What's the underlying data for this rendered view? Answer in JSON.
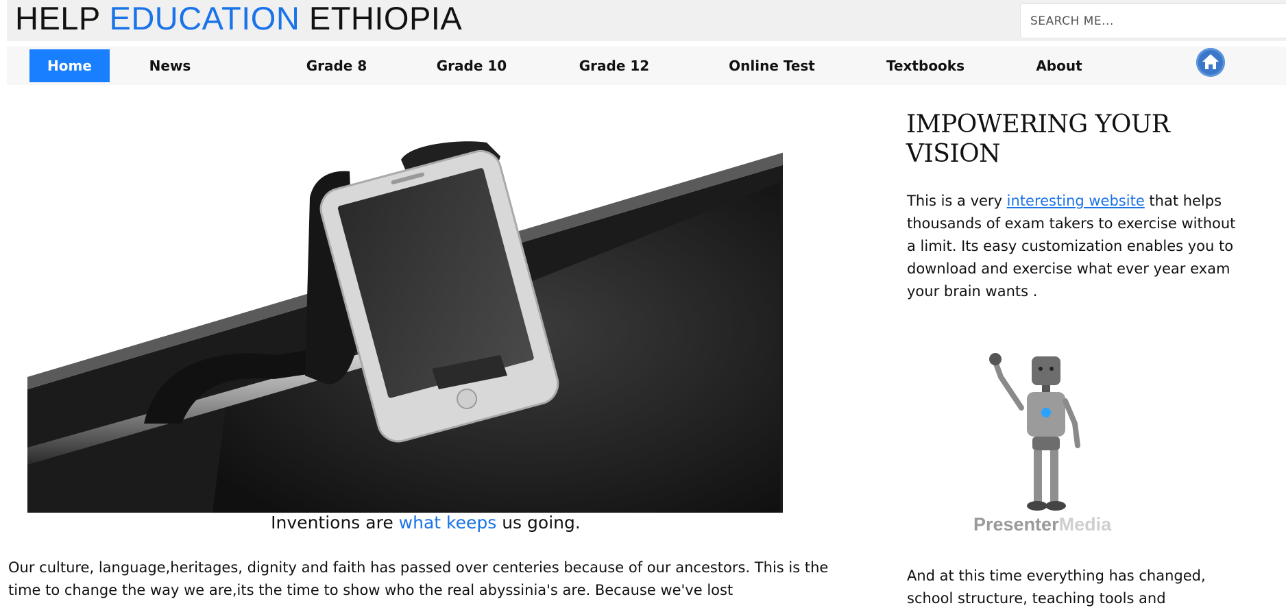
{
  "header": {
    "title_part1": "HELP ",
    "title_accent": "EDUCATION",
    "title_part2": " ETHIOPIA",
    "search_placeholder": "SEARCH ME..."
  },
  "nav": {
    "items": [
      {
        "label": "Home",
        "active": true
      },
      {
        "label": "News"
      },
      {
        "label": "Grade 8"
      },
      {
        "label": "Grade 10"
      },
      {
        "label": "Grade 12"
      },
      {
        "label": "Online Test"
      },
      {
        "label": "Textbooks"
      },
      {
        "label": "About"
      }
    ],
    "home_icon": "home-icon"
  },
  "main": {
    "caption_part1": "Inventions are ",
    "caption_accent": "what keeps",
    "caption_part2": " us going.",
    "body": "Our culture, language,heritages, dignity and faith has passed over centeries because of our ancestors. This is the time to change the way we are,its the time to show who the real abyssinia's are. Because we've lost"
  },
  "sidebar": {
    "title": "IMPOWERING YOUR VISION",
    "text_before_link": "This is a very ",
    "link": "interesting website",
    "text_after_link": " that helps thousands of exam takers to exercise without a limit. Its easy customization enables you to download and exercise what ever year exam your brain wants .",
    "image_brand_dark": "Presenter",
    "image_brand_light": "Media",
    "text2": "And at this time everything has changed, school structure, teaching tools and"
  },
  "colors": {
    "accent": "#1a73e8",
    "nav_active": "#1a7fff"
  }
}
